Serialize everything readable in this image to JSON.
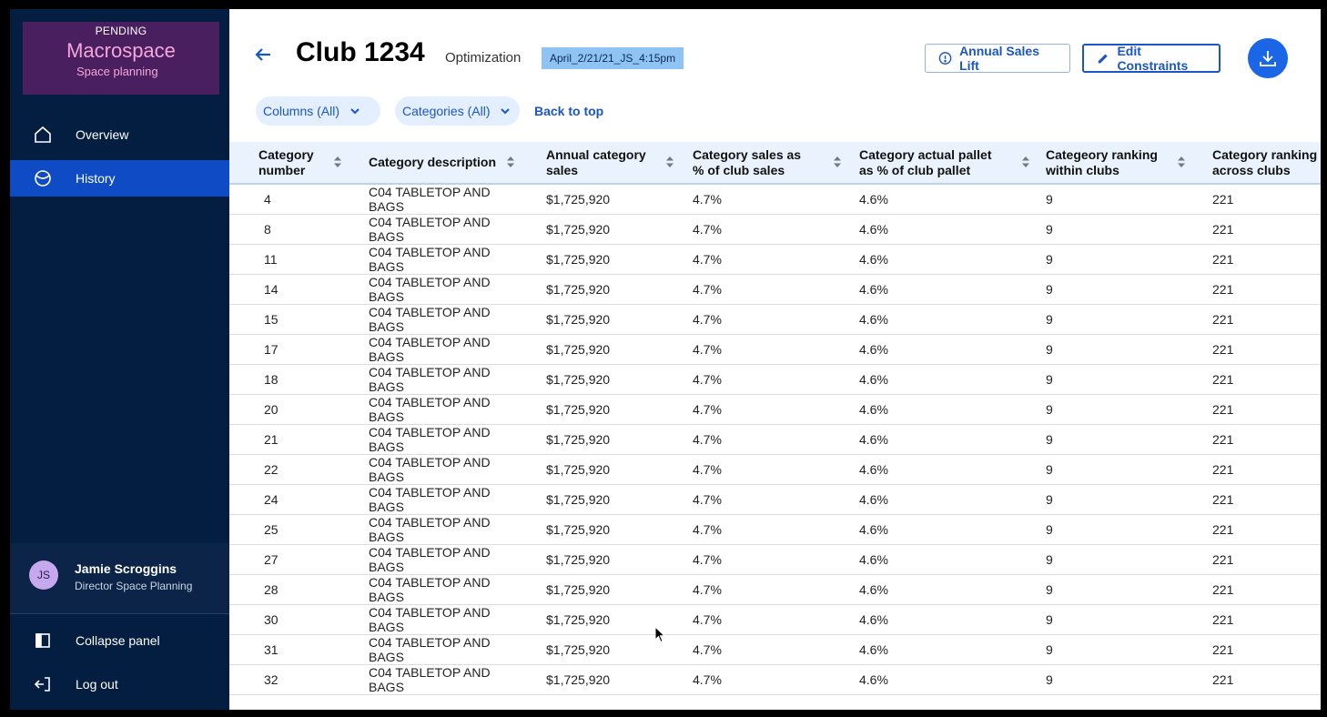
{
  "app": {
    "status": "PENDING",
    "name": "Macrospace",
    "subtitle": "Space planning"
  },
  "nav": {
    "overview": "Overview",
    "history": "History",
    "collapse": "Collapse panel",
    "logout": "Log out"
  },
  "user": {
    "initials": "JS",
    "name": "Jamie Scroggins",
    "role": "Director Space Planning"
  },
  "header": {
    "title": "Club 1234",
    "subtitle": "Optimization",
    "tag": "April_2/21/21_JS_4:15pm",
    "annual_sales_lift": "Annual Sales Lift",
    "edit_constraints": "Edit Constraints"
  },
  "filters": {
    "columns": "Columns (All)",
    "categories": "Categories (All)",
    "back_to_top": "Back to top"
  },
  "table": {
    "columns": [
      {
        "l1": "Category",
        "l2": "number"
      },
      {
        "l1": "Category description",
        "l2": ""
      },
      {
        "l1": "Annual category",
        "l2": "sales"
      },
      {
        "l1": "Category sales as",
        "l2": "% of club sales"
      },
      {
        "l1": "Category actual pallet",
        "l2": "as % of club pallet"
      },
      {
        "l1": "Categeory ranking",
        "l2": "within clubs"
      },
      {
        "l1": "Category ranking",
        "l2": "across clubs"
      }
    ],
    "rows": [
      [
        "4",
        "C04 TABLETOP AND BAGS",
        "$1,725,920",
        "4.7%",
        "4.6%",
        "9",
        "221"
      ],
      [
        "8",
        "C04 TABLETOP AND BAGS",
        "$1,725,920",
        "4.7%",
        "4.6%",
        "9",
        "221"
      ],
      [
        "11",
        "C04 TABLETOP AND BAGS",
        "$1,725,920",
        "4.7%",
        "4.6%",
        "9",
        "221"
      ],
      [
        "14",
        "C04 TABLETOP AND BAGS",
        "$1,725,920",
        "4.7%",
        "4.6%",
        "9",
        "221"
      ],
      [
        "15",
        "C04 TABLETOP AND BAGS",
        "$1,725,920",
        "4.7%",
        "4.6%",
        "9",
        "221"
      ],
      [
        "17",
        "C04 TABLETOP AND BAGS",
        "$1,725,920",
        "4.7%",
        "4.6%",
        "9",
        "221"
      ],
      [
        "18",
        "C04 TABLETOP AND BAGS",
        "$1,725,920",
        "4.7%",
        "4.6%",
        "9",
        "221"
      ],
      [
        "20",
        "C04 TABLETOP AND BAGS",
        "$1,725,920",
        "4.7%",
        "4.6%",
        "9",
        "221"
      ],
      [
        "21",
        "C04 TABLETOP AND BAGS",
        "$1,725,920",
        "4.7%",
        "4.6%",
        "9",
        "221"
      ],
      [
        "22",
        "C04 TABLETOP AND BAGS",
        "$1,725,920",
        "4.7%",
        "4.6%",
        "9",
        "221"
      ],
      [
        "24",
        "C04 TABLETOP AND BAGS",
        "$1,725,920",
        "4.7%",
        "4.6%",
        "9",
        "221"
      ],
      [
        "25",
        "C04 TABLETOP AND BAGS",
        "$1,725,920",
        "4.7%",
        "4.6%",
        "9",
        "221"
      ],
      [
        "27",
        "C04 TABLETOP AND BAGS",
        "$1,725,920",
        "4.7%",
        "4.6%",
        "9",
        "221"
      ],
      [
        "28",
        "C04 TABLETOP AND BAGS",
        "$1,725,920",
        "4.7%",
        "4.6%",
        "9",
        "221"
      ],
      [
        "30",
        "C04 TABLETOP AND BAGS",
        "$1,725,920",
        "4.7%",
        "4.6%",
        "9",
        "221"
      ],
      [
        "31",
        "C04 TABLETOP AND BAGS",
        "$1,725,920",
        "4.7%",
        "4.6%",
        "9",
        "221"
      ],
      [
        "32",
        "C04 TABLETOP AND BAGS",
        "$1,725,920",
        "4.7%",
        "4.6%",
        "9",
        "221"
      ]
    ]
  },
  "colors": {
    "sidebar": "#041e42",
    "active_nav": "#0f4bc4",
    "accent": "#1a56c6",
    "tag_bg": "#8fc3f4",
    "brand_bg": "#4a1f5f"
  }
}
